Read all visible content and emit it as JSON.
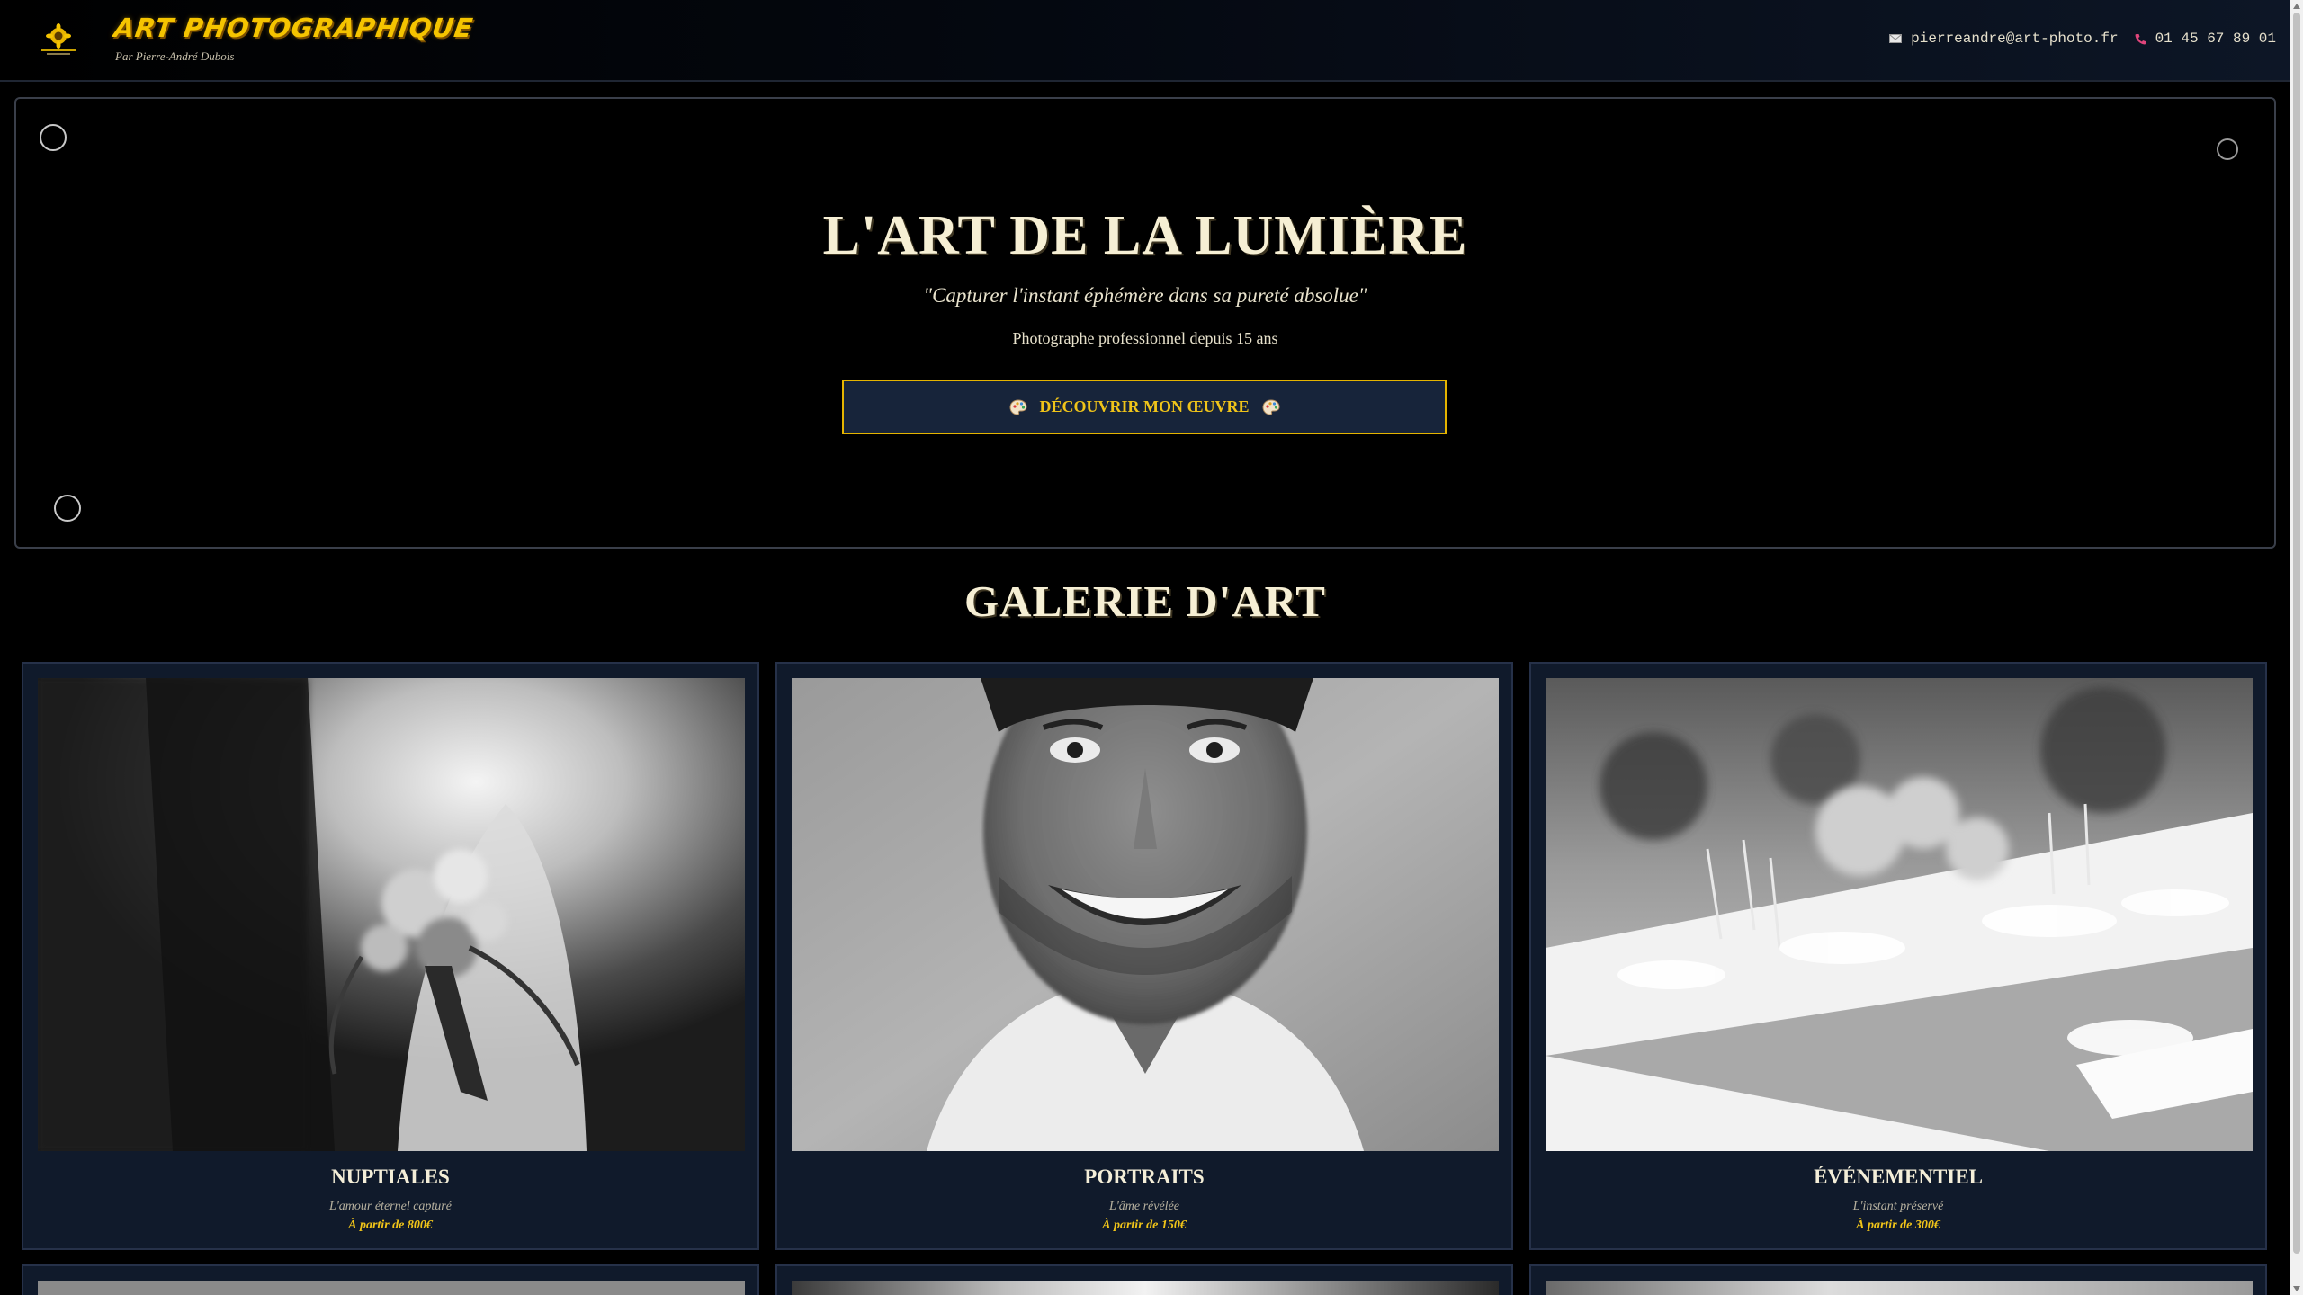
{
  "header": {
    "logo_icon": "sunflower-logo-icon",
    "title": "ART PHOTOGRAPHIQUE",
    "subtitle": "Par Pierre-André Dubois",
    "email_icon": "envelope-icon",
    "email": "pierreandre@art-photo.fr",
    "phone_icon": "phone-icon",
    "phone": "01 45 67 89 01"
  },
  "hero": {
    "title": "L'ART DE LA LUMIÈRE",
    "quote": "\"Capturer l'instant éphémère dans sa pureté absolue\"",
    "subtitle": "Photographe professionnel depuis 15 ans",
    "cta_label": "DÉCOUVRIR MON ŒUVRE",
    "cta_icon": "palette-icon"
  },
  "gallery": {
    "title": "GALERIE D'ART",
    "cards": [
      {
        "title": "NUPTIALES",
        "description": "L'amour éternel capturé",
        "price": "À partir de 800€",
        "photo": "wedding-bouquet-photo"
      },
      {
        "title": "PORTRAITS",
        "description": "L'âme révélée",
        "price": "À partir de 150€",
        "photo": "smiling-man-portrait-photo"
      },
      {
        "title": "ÉVÉNEMENTIEL",
        "description": "L'instant préservé",
        "price": "À partir de 300€",
        "photo": "banquet-table-photo"
      }
    ]
  },
  "colors": {
    "background": "#000000",
    "accent_gold": "#f0c419",
    "card_bg": "#101a2b",
    "cream_text": "#f4eed8"
  }
}
